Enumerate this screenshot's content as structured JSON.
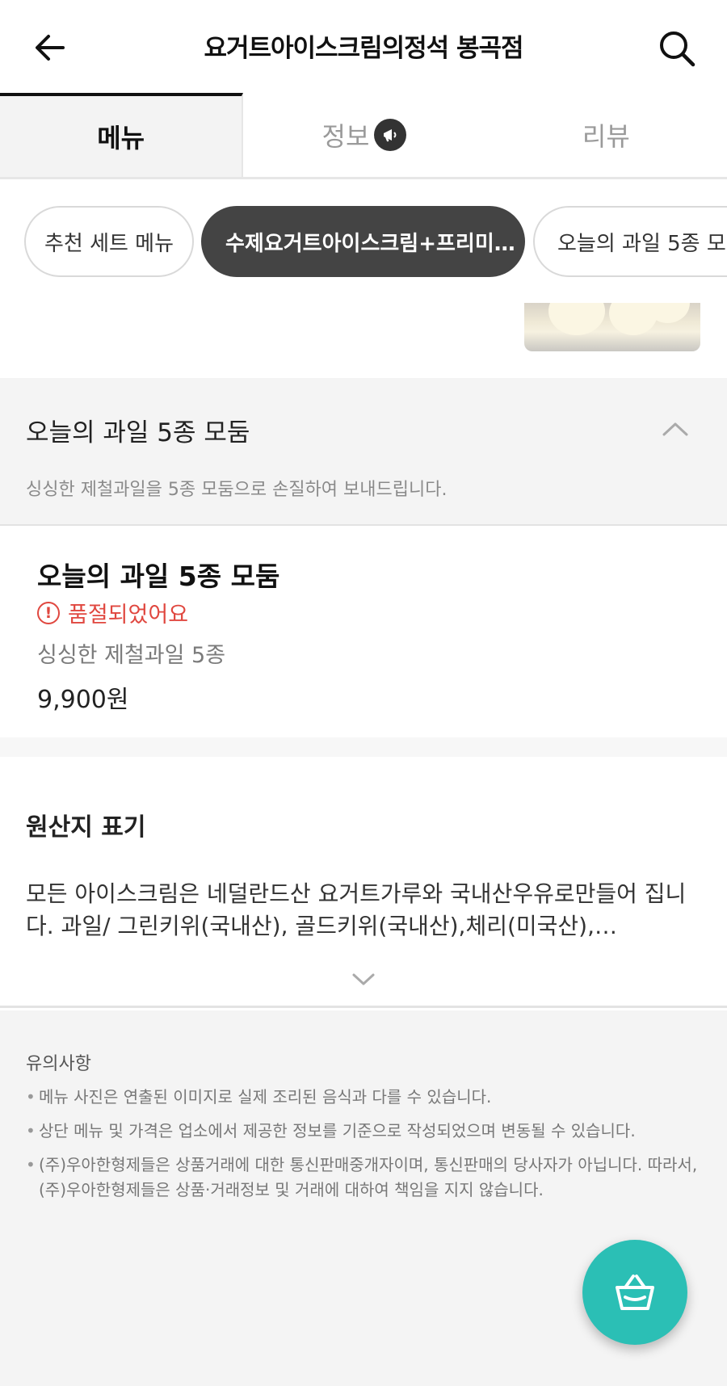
{
  "header": {
    "title": "요거트아이스크림의정석 봉곡점",
    "back_icon": "arrow-left-icon",
    "search_icon": "search-icon"
  },
  "tabs": [
    {
      "label": "메뉴",
      "active": true
    },
    {
      "label": "정보",
      "active": false,
      "icon": "megaphone-icon"
    },
    {
      "label": "리뷰",
      "active": false
    }
  ],
  "categories": [
    {
      "label": "추천 세트 메뉴",
      "active": false
    },
    {
      "label": "수제요거트아이스크림+프리미…",
      "active": true
    },
    {
      "label": "오늘의 과일 5종 모둠",
      "active": false
    }
  ],
  "section": {
    "name": "오늘의 과일 5종 모둠",
    "description": "싱싱한 제철과일을 5종 모둠으로 손질하여 보내드립니다.",
    "collapse_icon": "chevron-up-icon"
  },
  "menu_item": {
    "name": "오늘의 과일 5종 모둠",
    "status": "품절되었어요",
    "description": "싱싱한 제철과일 5종",
    "price": "9,900원"
  },
  "origin": {
    "title": "원산지 표기",
    "text": "모든 아이스크림은 네덜란드산 요거트가루와 국내산우유로만들어 집니다. 과일/ 그린키위(국내산), 골드키위(국내산),체리(미국산),…",
    "expand_icon": "chevron-down-icon"
  },
  "notice": {
    "title": "유의사항",
    "items": [
      "메뉴 사진은 연출된 이미지로 실제 조리된 음식과 다를 수 있습니다.",
      "상단 메뉴 및 가격은 업소에서 제공한 정보를 기준으로 작성되었으며 변동될 수 있습니다.",
      "(주)우아한형제들은 상품거래에 대한 통신판매중개자이며, 통신판매의 당사자가 아닙니다. 따라서, (주)우아한형제들은 상품·거래정보 및 거래에 대하여 책임을 지지 않습니다."
    ]
  },
  "cart_icon": "cart-basket-icon",
  "colors": {
    "accent": "#2bbfb5",
    "soldout": "#e0473f",
    "chip_active": "#444444"
  }
}
